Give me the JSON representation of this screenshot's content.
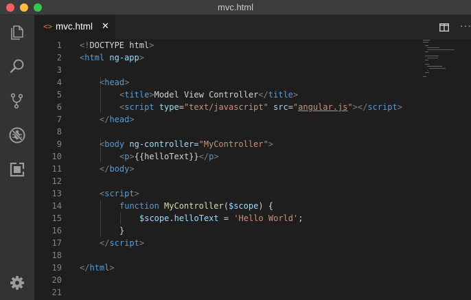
{
  "window": {
    "title": "mvc.html"
  },
  "activity_bar": {
    "icons": [
      "explorer-icon",
      "search-icon",
      "source-control-icon",
      "debug-icon",
      "extensions-icon",
      "settings-gear-icon"
    ]
  },
  "tab": {
    "icon": "<>",
    "label": "mvc.html",
    "close": "✕"
  },
  "editor_actions": {
    "more": "···"
  },
  "line_numbers": [
    "1",
    "2",
    "3",
    "4",
    "5",
    "6",
    "7",
    "8",
    "9",
    "10",
    "11",
    "12",
    "13",
    "14",
    "15",
    "16",
    "17",
    "18",
    "19",
    "20",
    "21"
  ],
  "code": {
    "l1": [
      "<!",
      "DOCTYPE html",
      ">"
    ],
    "l2": [
      "<",
      "html",
      " ng-app",
      ">"
    ],
    "l4": [
      "<",
      "head",
      ">"
    ],
    "l5": [
      "<",
      "title",
      ">",
      "Model View Controller",
      "</",
      "title",
      ">"
    ],
    "l6": [
      "<",
      "script",
      " type",
      "=",
      "\"text/javascript\"",
      " src",
      "=",
      "\"",
      "angular.js",
      "\"",
      "></",
      "script",
      ">"
    ],
    "l7": [
      "</",
      "head",
      ">"
    ],
    "l9": [
      "<",
      "body",
      " ng-controller",
      "=",
      "\"MyController\"",
      ">"
    ],
    "l10": [
      "<",
      "p",
      ">",
      "{{helloText}}",
      "</",
      "p",
      ">"
    ],
    "l11": [
      "</",
      "body",
      ">"
    ],
    "l13": [
      "<",
      "script",
      ">"
    ],
    "l14": [
      "function",
      " ",
      "MyController",
      "(",
      "$scope",
      ") {"
    ],
    "l15": [
      "$scope",
      ".",
      "helloText",
      " = ",
      "'Hello World'",
      ";"
    ],
    "l16": [
      "}"
    ],
    "l17": [
      "</",
      "script",
      ">"
    ],
    "l19": [
      "</",
      "html",
      ">"
    ]
  },
  "colors": {
    "tag": "#569cd6",
    "attribute": "#9cdcfe",
    "string": "#ce9178",
    "function": "#dcdcaa",
    "text": "#d4d4d4",
    "punctuation": "#808080",
    "tab_icon": "#e37933"
  }
}
